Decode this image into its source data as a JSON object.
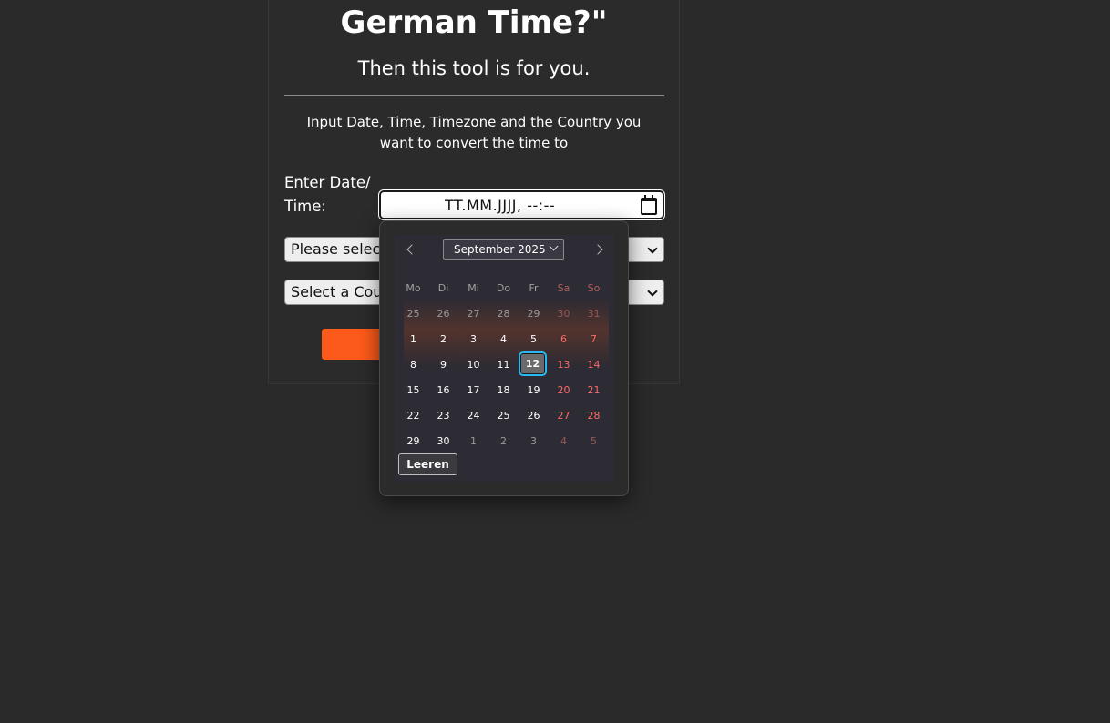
{
  "header": {
    "title": "German Time?\"",
    "subtitle": "Then this tool is for you."
  },
  "form": {
    "instructions": "Input Date, Time, Timezone and the Country you want to convert the time to",
    "datetime_label": "Enter Date/ Time:",
    "datetime_value": "TT.MM.JJJJ,  --:--",
    "timezone_select": "Please select",
    "country_select": "Select a Coun",
    "button_color": "#fc5a1a"
  },
  "datepicker": {
    "month_year": "September 2025",
    "weekdays": [
      "Mo",
      "Di",
      "Mi",
      "Do",
      "Fr",
      "Sa",
      "So"
    ],
    "weeks": [
      [
        "25",
        "26",
        "27",
        "28",
        "29",
        "30",
        "31"
      ],
      [
        "1",
        "2",
        "3",
        "4",
        "5",
        "6",
        "7"
      ],
      [
        "8",
        "9",
        "10",
        "11",
        "12",
        "13",
        "14"
      ],
      [
        "15",
        "16",
        "17",
        "18",
        "19",
        "20",
        "21"
      ],
      [
        "22",
        "23",
        "24",
        "25",
        "26",
        "27",
        "28"
      ],
      [
        "29",
        "30",
        "1",
        "2",
        "3",
        "4",
        "5"
      ]
    ],
    "today": "12",
    "clear_label": "Leeren",
    "highlight_color": "#2ab8f2",
    "weekend_color": "#ff6a6a"
  }
}
